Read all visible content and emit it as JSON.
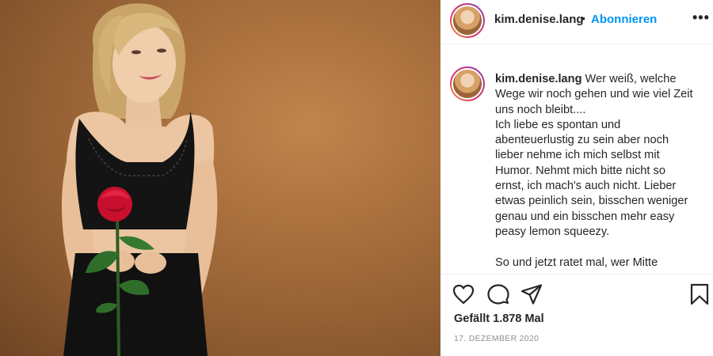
{
  "post": {
    "username": "kim.denise.lang",
    "separator": "•",
    "follow_label": "Abonnieren",
    "more_icon": "more-options-icon",
    "caption_user": "kim.denise.lang",
    "caption_text": " Wer weiß, welche\nWege wir noch gehen und wie viel Zeit\nuns noch bleibt....\nIch liebe es spontan und\nabenteuerlustig zu sein aber noch\nlieber nehme ich mich selbst mit\nHumor. Nehmt mich bitte nicht so\nernst, ich mach's auch nicht. Lieber\netwas peinlich sein, bisschen weniger\ngenau und ein bisschen mehr easy\npeasy lemon squeezy.\n\nSo und jetzt ratet mal, wer Mitte",
    "likes": "Gefällt 1.878 Mal",
    "date": "17. DEZEMBER 2020"
  },
  "icons": {
    "like": "heart-icon",
    "comment": "comment-icon",
    "share": "paper-plane-icon",
    "save": "bookmark-icon"
  },
  "colors": {
    "follow_blue": "#0095f6",
    "text": "#262626",
    "muted": "#8e8e8e",
    "photo_background": "#a86f3d",
    "rose_red": "#c8102e"
  }
}
